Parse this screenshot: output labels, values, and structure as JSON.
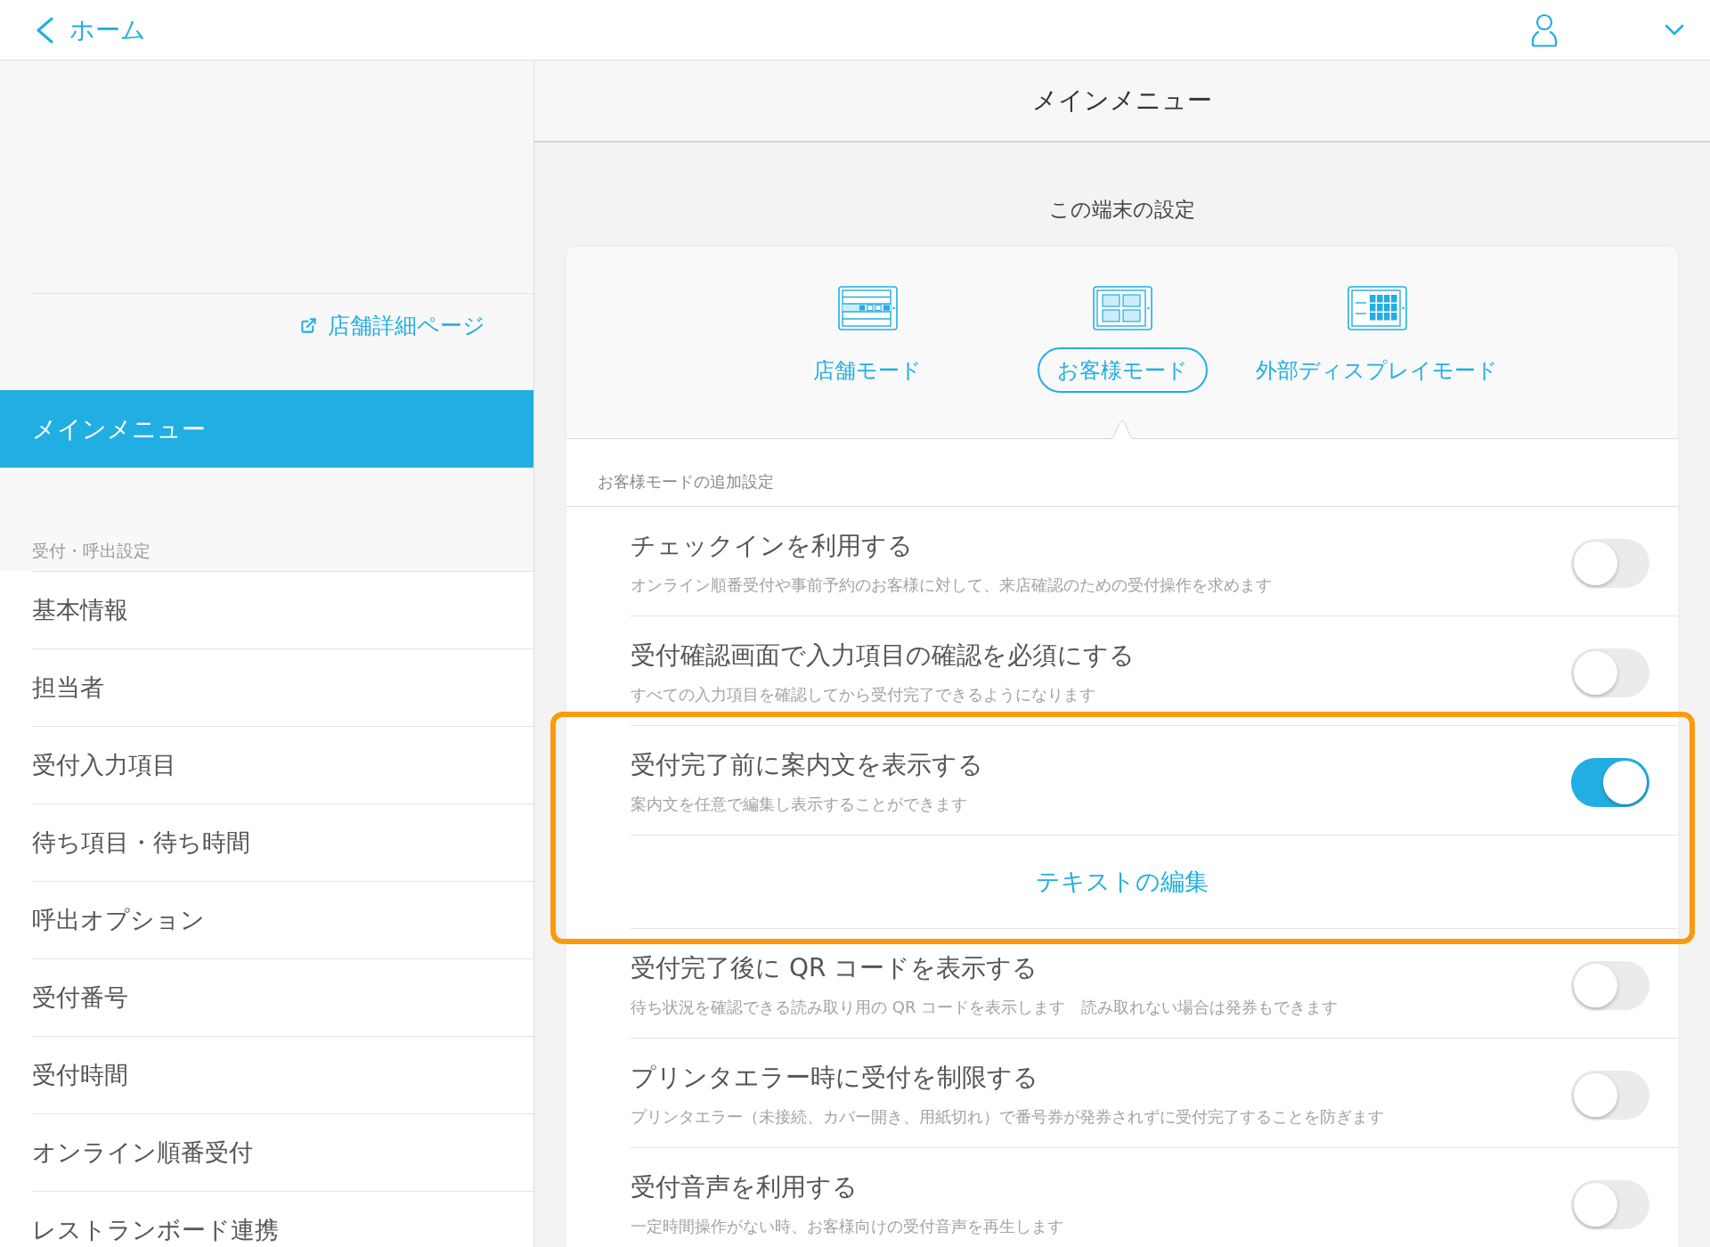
{
  "top_bar": {
    "back_label": "ホーム"
  },
  "sidebar": {
    "store_link": "店舗詳細ページ",
    "items": [
      {
        "label": "メインメニュー",
        "selected": true
      }
    ],
    "section": {
      "heading": "受付・呼出設定",
      "items": [
        {
          "label": "基本情報",
          "selected": false
        },
        {
          "label": "担当者",
          "selected": false
        },
        {
          "label": "受付入力項目",
          "selected": false
        },
        {
          "label": "待ち項目・待ち時間",
          "selected": false
        },
        {
          "label": "呼出オプション",
          "selected": false
        },
        {
          "label": "受付番号",
          "selected": false
        },
        {
          "label": "受付時間",
          "selected": false
        },
        {
          "label": "オンライン順番受付",
          "selected": false
        },
        {
          "label": "レストランボード連携",
          "selected": false
        }
      ]
    }
  },
  "main": {
    "title": "メインメニュー",
    "heading": "この端末の設定",
    "modes": [
      {
        "kind": "store",
        "label": "店舗モード",
        "selected": false
      },
      {
        "kind": "customer",
        "label": "お客様モード",
        "selected": true
      },
      {
        "kind": "display",
        "label": "外部ディスプレイモード",
        "selected": false
      }
    ],
    "section_label": "お客様モードの追加設定",
    "rows": [
      {
        "title": "チェックインを利用する",
        "description": "オンライン順番受付や事前予約のお客様に対して、来店確認のための受付操作を求めます",
        "on": false,
        "highlighted": false
      },
      {
        "title": "受付確認画面で入力項目の確認を必須にする",
        "description": "すべての入力項目を確認してから受付完了できるようになります",
        "on": false,
        "highlighted": false
      },
      {
        "title": "受付完了前に案内文を表示する",
        "description": "案内文を任意で編集し表示することができます",
        "on": true,
        "highlighted": true,
        "action": "テキストの編集"
      },
      {
        "title": "受付完了後に QR コードを表示する",
        "description": "待ち状況を確認できる読み取り用の QR コードを表示します　読み取れない場合は発券もできます",
        "on": false,
        "highlighted": false
      },
      {
        "title": "プリンタエラー時に受付を制限する",
        "description": "プリンタエラー（未接続、カバー開き、用紙切れ）で番号券が発券されずに受付完了することを防ぎます",
        "on": false,
        "highlighted": false
      },
      {
        "title": "受付音声を利用する",
        "description": "一定時間操作がない時、お客様向けの受付音声を再生します",
        "on": false,
        "highlighted": false
      }
    ]
  }
}
